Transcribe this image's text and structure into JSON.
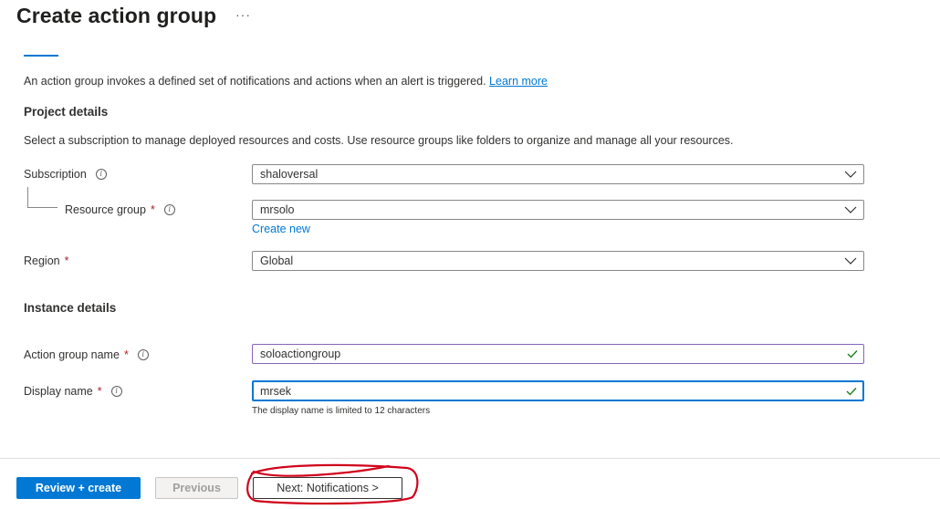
{
  "header": {
    "title": "Create action group",
    "more_label": "···"
  },
  "intro": {
    "text": "An action group invokes a defined set of notifications and actions when an alert is triggered.",
    "learn_more": "Learn more"
  },
  "project": {
    "heading": "Project details",
    "description": "Select a subscription to manage deployed resources and costs. Use resource groups like folders to organize and manage all your resources.",
    "subscription_label": "Subscription",
    "subscription_value": "shaloversal",
    "resource_group_label": "Resource group",
    "resource_group_value": "mrsolo",
    "create_new": "Create new",
    "region_label": "Region",
    "region_value": "Global"
  },
  "instance": {
    "heading": "Instance details",
    "action_group_name_label": "Action group name",
    "action_group_name_value": "soloactiongroup",
    "display_name_label": "Display name",
    "display_name_value": "mrsek",
    "display_name_hint": "The display name is limited to 12 characters"
  },
  "footer": {
    "review_create": "Review + create",
    "previous": "Previous",
    "next": "Next: Notifications >"
  },
  "required_marker": "*",
  "info_glyph": "i",
  "icons": {
    "dropdown": "chevron-down-icon",
    "valid": "checkmark-icon",
    "info": "info-icon"
  },
  "colors": {
    "accent": "#0078d4",
    "required": "#a4262c",
    "valid": "#107c10",
    "annotation": "#d0021b"
  }
}
